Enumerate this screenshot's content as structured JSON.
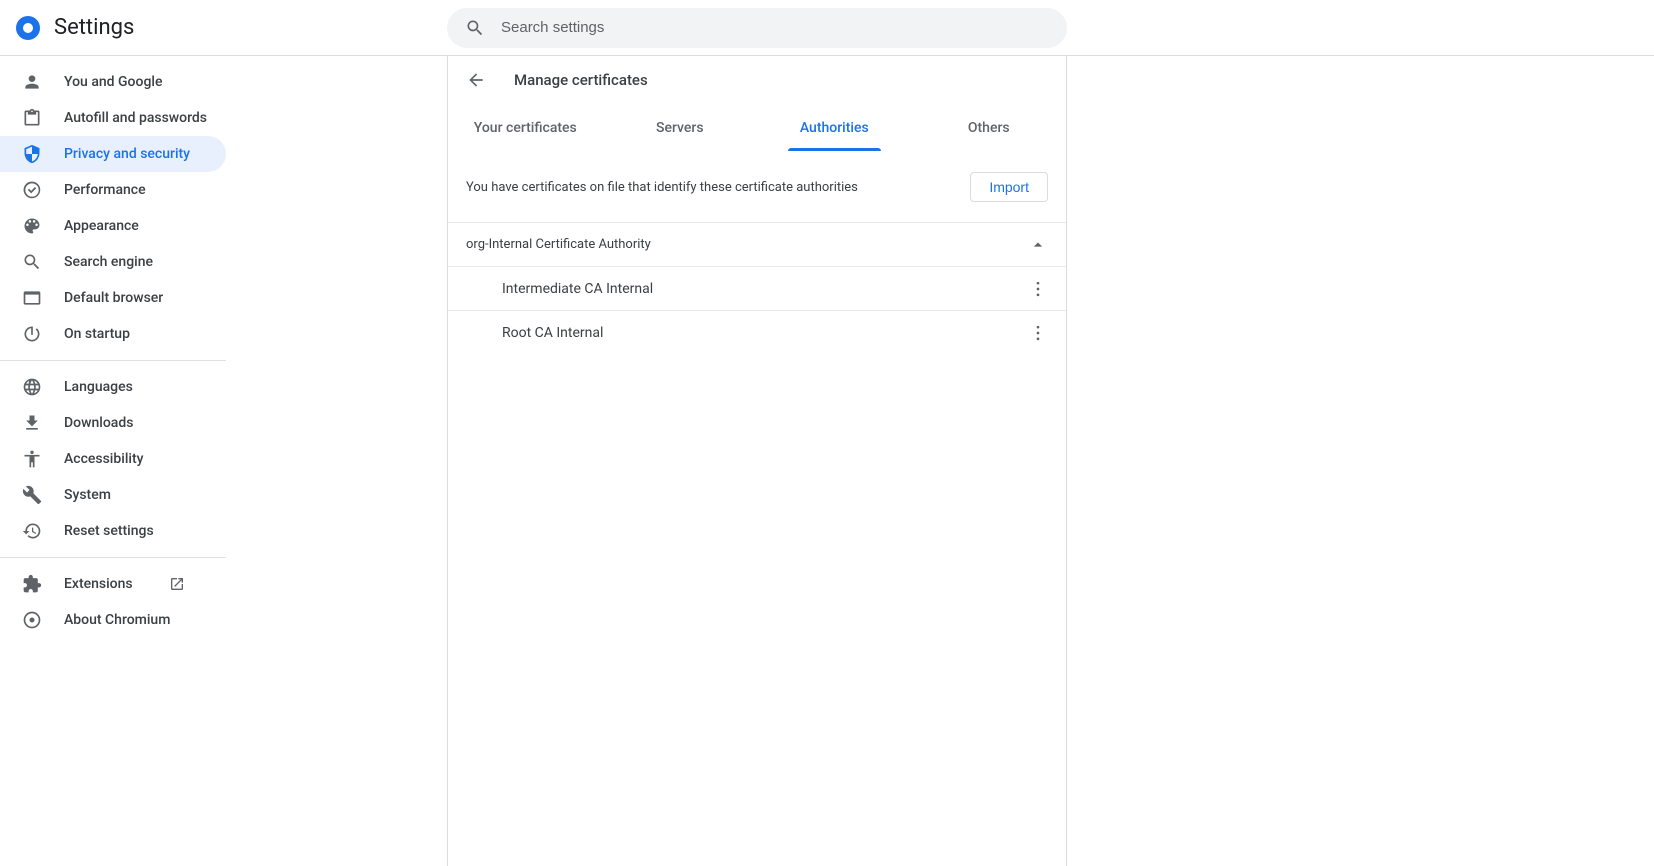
{
  "app": {
    "title": "Settings"
  },
  "search": {
    "placeholder": "Search settings"
  },
  "sidebar": {
    "groups": [
      [
        {
          "label": "You and Google"
        },
        {
          "label": "Autofill and passwords"
        },
        {
          "label": "Privacy and security"
        },
        {
          "label": "Performance"
        },
        {
          "label": "Appearance"
        },
        {
          "label": "Search engine"
        },
        {
          "label": "Default browser"
        },
        {
          "label": "On startup"
        }
      ],
      [
        {
          "label": "Languages"
        },
        {
          "label": "Downloads"
        },
        {
          "label": "Accessibility"
        },
        {
          "label": "System"
        },
        {
          "label": "Reset settings"
        }
      ],
      [
        {
          "label": "Extensions"
        },
        {
          "label": "About Chromium"
        }
      ]
    ]
  },
  "page": {
    "title": "Manage certificates",
    "tabs": [
      "Your certificates",
      "Servers",
      "Authorities",
      "Others"
    ],
    "active_tab": 2,
    "description": "You have certificates on file that identify these certificate authorities",
    "import_label": "Import",
    "orgs": [
      {
        "name": "org-Internal Certificate Authority",
        "expanded": true,
        "certs": [
          "Intermediate CA Internal",
          "Root CA Internal"
        ]
      }
    ]
  }
}
